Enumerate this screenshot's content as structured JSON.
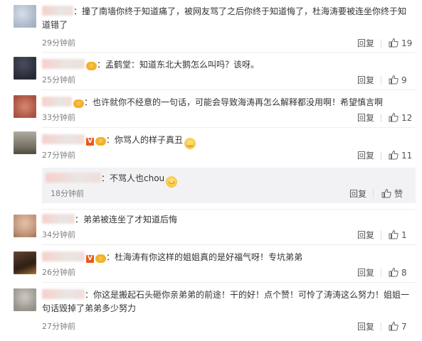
{
  "comments": [
    {
      "text_line1": "：撞了南墙你终于知道痛了，被网友骂了之后你终于知道悔了，杜海涛要被连坐你终于知",
      "text_line2": "道错了",
      "time": "29分钟前",
      "reply_label": "回复",
      "likes": "19",
      "avatar_color": "#b9c6d8"
    },
    {
      "text": "：孟鹤堂：知道东北大鹅怎么叫吗？该呀。",
      "time": "25分钟前",
      "reply_label": "回复",
      "likes": "9",
      "avatar_color": "#2d3241"
    },
    {
      "text": "：也许就你不经意的一句话，可能会导致海涛再怎么解释都没用啊！希望慎言啊",
      "time": "33分钟前",
      "reply_label": "回复",
      "likes": "12",
      "avatar_color": "#c46a57"
    },
    {
      "text": "：你骂人的样子真丑",
      "emoji": "smirk-emoji",
      "time": "27分钟前",
      "reply_label": "回复",
      "likes": "11",
      "avatar_color": "#8a8d84",
      "sub_reply": {
        "text": "：不骂人也chou",
        "emoji": "laugh-emoji",
        "time": "18分钟前",
        "reply_label": "回复",
        "like_label": "赞"
      }
    },
    {
      "text": "：弟弟被连坐了才知道后悔",
      "time": "34分钟前",
      "reply_label": "回复",
      "likes": "1",
      "avatar_color": "#c79b84"
    },
    {
      "text": "：杜海涛有你这样的姐姐真的是好福气呀！专坑弟弟",
      "time": "26分钟前",
      "reply_label": "回复",
      "likes": "8",
      "avatar_color": "#3c2a1e"
    },
    {
      "text_line1": "：你这是搬起石头砸你亲弟弟的前途！干的好！点个赞！可怜了涛涛这么努力！姐姐一",
      "text_line2": "句话毁掉了弟弟多少努力",
      "time": "27分钟前",
      "reply_label": "回复",
      "likes": "7",
      "avatar_color": "#a7a59f"
    }
  ],
  "colors": {
    "text": "#333333",
    "meta": "#808080",
    "subreply_bg": "#f2f2f5",
    "vip_badge": "#f3b229",
    "verified_badge": "#e8591a"
  }
}
